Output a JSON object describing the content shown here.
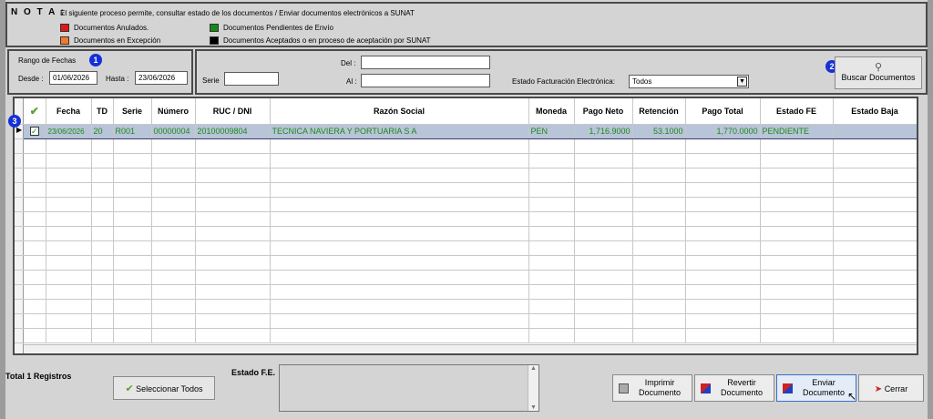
{
  "nota": {
    "title": "N O T A :",
    "text": "El siguiente proceso permite, consultar estado de los documentos / Enviar documentos electrónicos a SUNAT",
    "legend": [
      {
        "label": "Documentos Anulados.",
        "color": "#e01818"
      },
      {
        "label": "Documentos en Excepción",
        "color": "#f07a30"
      },
      {
        "label": "Documentos Pendientes de Envío",
        "color": "#158a15"
      },
      {
        "label": "Documentos Aceptados o en proceso de aceptación por SUNAT",
        "color": "#000000"
      }
    ]
  },
  "filters": {
    "rango_title": "Rango de Fechas",
    "desde_label": "Desde :",
    "desde_value": "01/06/2026",
    "hasta_label": "Hasta :",
    "hasta_value": "23/06/2026",
    "serie_label": "Serie",
    "serie_value": "",
    "del_label": "Del :",
    "del_value": "",
    "al_label": "Al :",
    "al_value": "",
    "estado_label": "Estado Facturación Electrónica:",
    "estado_value": "Todos",
    "buscar_label": "Buscar Documentos"
  },
  "badges": {
    "b1": "1",
    "b2": "2",
    "b3": "3"
  },
  "grid": {
    "columns": [
      "",
      "Fecha",
      "TD",
      "Serie",
      "Número",
      "RUC / DNI",
      "Razón Social",
      "Moneda",
      "Pago Neto",
      "Retención",
      "Pago Total",
      "Estado FE",
      "Estado Baja"
    ],
    "rows": [
      [
        "✓",
        "23/06/2026",
        "20",
        "R001",
        "00000004",
        "20100009804",
        "TECNICA NAVIERA Y PORTUARIA S A",
        "PEN",
        "1,716.9000",
        "53.1000",
        "1,770.0000",
        "PENDIENTE",
        ""
      ]
    ]
  },
  "footer": {
    "total_label": "Total 1 Registros",
    "seleccionar_label": "Seleccionar Todos",
    "estado_fe_label": "Estado F.E.",
    "imprimir_label_1": "Imprimir",
    "imprimir_label_2": "Documento",
    "revertir_label_1": "Revertir",
    "revertir_label_2": "Documento",
    "enviar_label_1": "Enviar",
    "enviar_label_2": "Documento",
    "cerrar_label": "Cerrar"
  },
  "colors": {
    "pending_text": "#1b8a1b",
    "selected_row": "#b8c4d8",
    "badge": "#1530d8"
  }
}
